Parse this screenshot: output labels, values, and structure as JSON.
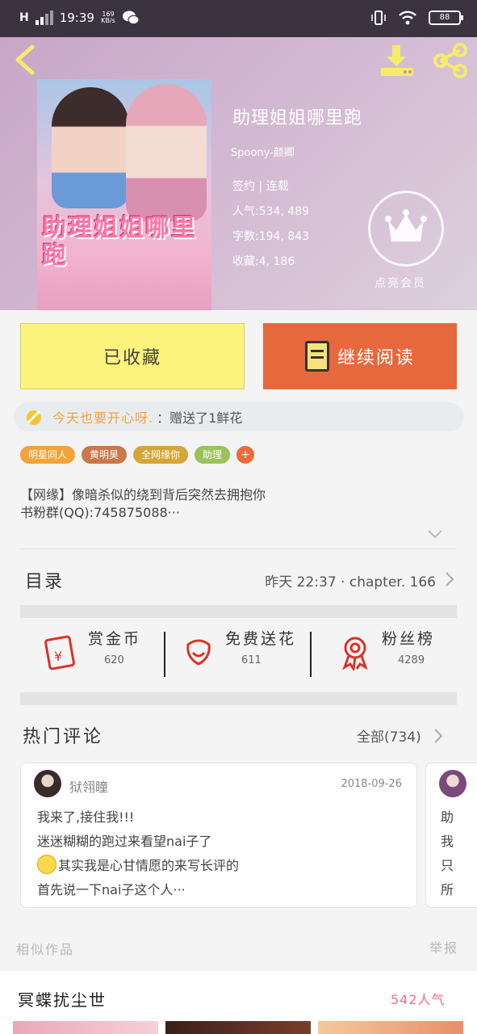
{
  "status_bar": {
    "time": "19:39",
    "net_speed": "169 KB/s",
    "battery": "88"
  },
  "header": {
    "cover_title_art": "助理姐姐哪里跑",
    "book_title": "助理姐姐哪里跑",
    "author": "Spoony-颜卿",
    "status_line": "签约 | 连载",
    "popularity": "人气:534, 489",
    "word_count": "字数:194, 843",
    "favorites": "收藏:4, 186",
    "vip_label": "点亮会员"
  },
  "actions": {
    "favorite_label": "已收藏",
    "read_label": "继续阅读"
  },
  "flower_bar": {
    "greeting": "今天也要开心呀.",
    "gift_text": "：赠送了1鲜花"
  },
  "tags": [
    {
      "label": "明星同人",
      "color": "#f2a43a"
    },
    {
      "label": "黄明昊",
      "color": "#c9784a"
    },
    {
      "label": "全网缘你",
      "color": "#d3a53a"
    },
    {
      "label": "助理",
      "color": "#9cc25a"
    }
  ],
  "tag_add_label": "+",
  "intro": {
    "line1": "【网缘】像暗杀似的绕到背后突然去拥抱你",
    "line2": "书粉群(QQ):745875088···"
  },
  "toc": {
    "label": "目录",
    "latest": "昨天 22:37 · chapter. 166"
  },
  "stats": [
    {
      "name": "赏金币",
      "count": "620"
    },
    {
      "name": "免费送花",
      "count": "611"
    },
    {
      "name": "粉丝榜",
      "count": "4289"
    }
  ],
  "comments_section": {
    "title": "热门评论",
    "all_label": "全部(734)"
  },
  "comment": {
    "user": "狱翎瞳",
    "date": "2018-09-26",
    "line1": "我来了,接住我!!!",
    "line2": "迷迷糊糊的跑过来看望nai子了",
    "line3": "其实我是心甘情愿的来写长评的",
    "line4": "首先说一下nai子这个人···"
  },
  "comment2": {
    "line1": "助",
    "line2": "我",
    "line3": "只",
    "line4": "所"
  },
  "footer_links": {
    "similar": "相似作品",
    "report": "举报"
  },
  "similar_book": {
    "title": "冥蝶扰尘世",
    "popularity": "542人气"
  }
}
